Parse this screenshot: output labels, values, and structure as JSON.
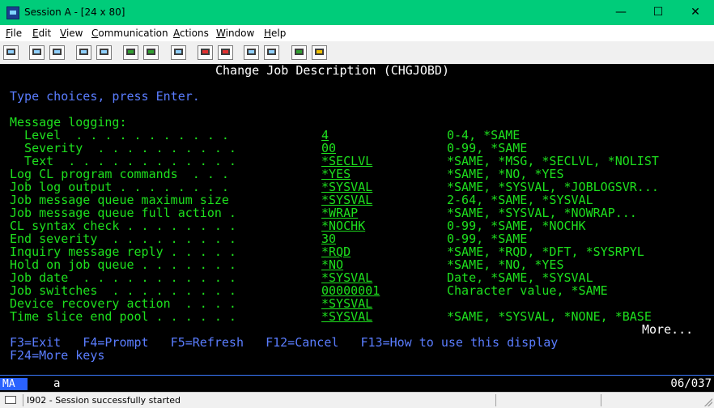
{
  "window": {
    "title": "Session A - [24 x 80]",
    "minimize": "—",
    "maximize": "☐",
    "close": "✕"
  },
  "menu": [
    {
      "key": "F",
      "rest": "ile"
    },
    {
      "key": "E",
      "rest": "dit"
    },
    {
      "key": "V",
      "rest": "iew"
    },
    {
      "key": "C",
      "rest": "ommunication"
    },
    {
      "key": "A",
      "rest": "ctions"
    },
    {
      "key": "W",
      "rest": "indow"
    },
    {
      "key": "H",
      "rest": "elp"
    }
  ],
  "toolbar_icons": [
    "print-screen-icon",
    "copy-icon",
    "paste-icon",
    "send-icon",
    "receive-icon",
    "display-icon",
    "keyboard-icon",
    "macro-icon",
    "record-macro-icon",
    "play-macro-icon",
    "stop-macro-icon",
    "globe-icon",
    "edit-icon"
  ],
  "screen": {
    "title": "Change Job Description (CHGJOBD)",
    "instruction": "Type choices, press Enter.",
    "section": "Message logging:",
    "rows": [
      {
        "label": "  Level  . . . . . . . . . . .",
        "value": "4",
        "choices": "0-4, *SAME"
      },
      {
        "label": "  Severity  . . . . . . . . . .",
        "value": "00",
        "choices": "0-99, *SAME"
      },
      {
        "label": "  Text  . . . . . . . . . . . .",
        "value": "*SECLVL",
        "choices": "*SAME, *MSG, *SECLVL, *NOLIST"
      },
      {
        "label": "Log CL program commands  . . .",
        "value": "*YES",
        "choices": "*SAME, *NO, *YES"
      },
      {
        "label": "Job log output . . . . . . . .",
        "value": "*SYSVAL",
        "choices": "*SAME, *SYSVAL, *JOBLOGSVR..."
      },
      {
        "label": "Job message queue maximum size",
        "value": "*SYSVAL",
        "choices": "2-64, *SAME, *SYSVAL"
      },
      {
        "label": "Job message queue full action .",
        "value": "*WRAP",
        "choices": "*SAME, *SYSVAL, *NOWRAP..."
      },
      {
        "label": "CL syntax check . . . . . . . .",
        "value": "*NOCHK",
        "choices": "0-99, *SAME, *NOCHK"
      },
      {
        "label": "End severity  . . . . . . . . .",
        "value": "30",
        "choices": "0-99, *SAME"
      },
      {
        "label": "Inquiry message reply . . . . .",
        "value": "*RQD",
        "choices": "*SAME, *RQD, *DFT, *SYSRPYL"
      },
      {
        "label": "Hold on job queue . . . . . . .",
        "value": "*NO",
        "choices": "*SAME, *NO, *YES"
      },
      {
        "label": "Job date  . . . . . . . . . . .",
        "value": "*SYSVAL",
        "choices": "Date, *SAME, *SYSVAL"
      },
      {
        "label": "Job switches  . . . . . . . . .",
        "value": "00000001",
        "choices": "Character value, *SAME"
      },
      {
        "label": "Device recovery action  . . . .",
        "value": "*SYSVAL",
        "choices": ""
      },
      {
        "label": "Time slice end pool . . . . . .",
        "value": "*SYSVAL",
        "choices": "*SAME, *SYSVAL, *NONE, *BASE"
      }
    ],
    "more": "More...",
    "fkeys1": "F3=Exit   F4=Prompt   F5=Refresh   F12=Cancel   F13=How to use this display",
    "fkeys2": "F24=More keys"
  },
  "oia": {
    "mode": "MA",
    "indicator": "a",
    "cursor_pos": "06/037"
  },
  "status": {
    "message": "I902 - Session successfully started"
  },
  "colors": {
    "titlebar": "#00cc7a",
    "label_blue": "#5a7dff",
    "field_green": "#1ee01e",
    "oia_mode": "#2a62ff"
  }
}
